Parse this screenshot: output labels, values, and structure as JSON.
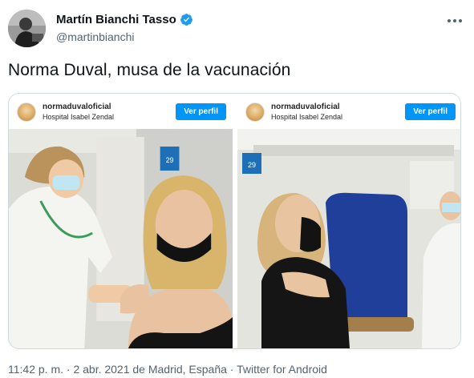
{
  "author": {
    "name": "Martín Bianchi Tasso",
    "handle": "@martinbianchi",
    "verified": true
  },
  "more_icon": "more-horizontal-icon",
  "tweet": {
    "text": "Norma Duval, musa de la vacunación"
  },
  "media": [
    {
      "ig_username": "normaduvaloficial",
      "ig_location": "Hospital Isabel Zendal",
      "ig_button": "Ver perfil",
      "sign_number": "29"
    },
    {
      "ig_username": "normaduvaloficial",
      "ig_location": "Hospital Isabel Zendal",
      "ig_button": "Ver perfil",
      "sign_number": "29"
    }
  ],
  "meta": {
    "text": "11:42 p. m. · 2 abr. 2021 de Madrid, España · Twitter for Android"
  },
  "colors": {
    "accent": "#1d9bf0",
    "instagram_button": "#0095f6",
    "secondary_text": "#536471"
  }
}
